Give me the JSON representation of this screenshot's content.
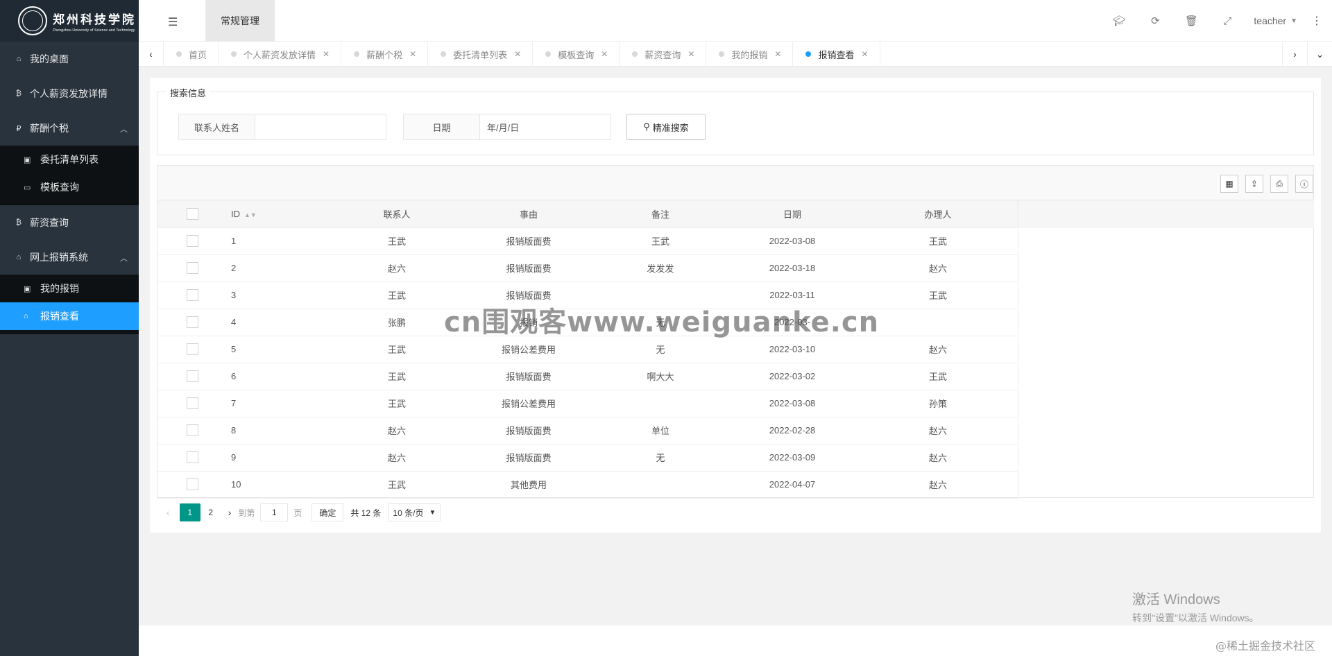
{
  "sidebar": {
    "logo_text": "郑州科技学院",
    "logo_subtext": "Zhengzhou University of Science and Technology",
    "items": [
      {
        "label": "我的桌面",
        "icon": "home-icon"
      },
      {
        "label": "个人薪资发放详情",
        "icon": "bitcoin-icon"
      },
      {
        "label": "薪酬个税",
        "icon": "rouble-icon",
        "arrow": "︿"
      },
      {
        "label": "薪资查询",
        "icon": "bitcoin-icon"
      },
      {
        "label": "网上报销系统",
        "icon": "home-icon",
        "arrow": "︿"
      }
    ],
    "sub_tax": [
      {
        "label": "委托清单列表",
        "icon": "money-icon"
      },
      {
        "label": "模板查询",
        "icon": "window-icon"
      }
    ],
    "sub_reimb": [
      {
        "label": "我的报销",
        "icon": "money-icon"
      },
      {
        "label": "报销查看",
        "icon": "home-icon"
      }
    ]
  },
  "header": {
    "menu_tab": "常规管理",
    "user": "teacher"
  },
  "tabs": [
    {
      "label": "首页"
    },
    {
      "label": "个人薪资发放详情"
    },
    {
      "label": "薪酬个税"
    },
    {
      "label": "委托清单列表"
    },
    {
      "label": "模板查询"
    },
    {
      "label": "薪资查询"
    },
    {
      "label": "我的报销"
    },
    {
      "label": "报销查看"
    }
  ],
  "search": {
    "legend": "搜索信息",
    "name_label": "联系人姓名",
    "name_value": "",
    "date_label": "日期",
    "date_placeholder": "年/月/日",
    "button": "精准搜索"
  },
  "table": {
    "columns": [
      "ID",
      "联系人",
      "事由",
      "备注",
      "日期",
      "办理人"
    ],
    "rows": [
      [
        "1",
        "王武",
        "报销版面费",
        "王武",
        "2022-03-08",
        "王武"
      ],
      [
        "2",
        "赵六",
        "报销版面费",
        "发发发",
        "2022-03-18",
        "赵六"
      ],
      [
        "3",
        "王武",
        "报销版面费",
        "",
        "2022-03-11",
        "王武"
      ],
      [
        "4",
        "张鹏",
        "报销",
        "无",
        "2022-03-",
        ""
      ],
      [
        "5",
        "王武",
        "报销公差费用",
        "无",
        "2022-03-10",
        "赵六"
      ],
      [
        "6",
        "王武",
        "报销版面费",
        "啊大大",
        "2022-03-02",
        "王武"
      ],
      [
        "7",
        "王武",
        "报销公差费用",
        "",
        "2022-03-08",
        "孙策"
      ],
      [
        "8",
        "赵六",
        "报销版面费",
        "单位",
        "2022-02-28",
        "赵六"
      ],
      [
        "9",
        "赵六",
        "报销版面费",
        "无",
        "2022-03-09",
        "赵六"
      ],
      [
        "10",
        "王武",
        "其他费用",
        "",
        "2022-04-07",
        "赵六"
      ]
    ]
  },
  "pager": {
    "current": "1",
    "page2": "2",
    "goto_label": "到第",
    "goto_value": "1",
    "page_unit": "页",
    "confirm": "确定",
    "total": "共 12 条",
    "per_page": "10 条/页"
  },
  "overlay": {
    "watermark": "cn围观客www.weiguanke.cn",
    "win_title": "激活 Windows",
    "win_sub": "转到\"设置\"以激活 Windows。",
    "juejin": "@稀土掘金技术社区"
  }
}
